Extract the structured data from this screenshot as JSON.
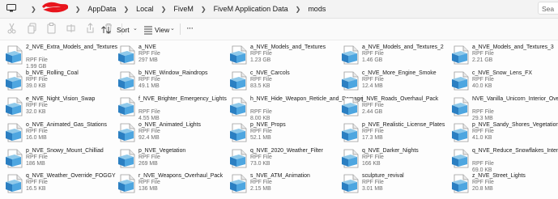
{
  "address": {
    "crumbs": [
      "AppData",
      "Local",
      "FiveM",
      "FiveM Application Data",
      "mods"
    ],
    "search_placeholder": "Sea"
  },
  "toolbar": {
    "sort_label": "Sort",
    "view_label": "View",
    "more_label": "···"
  },
  "files": [
    {
      "name": "2_NVE_Extra_Models_and_Textures",
      "type": "RPF File",
      "size": "1.99 GB"
    },
    {
      "name": "a_NVE",
      "type": "RPF File",
      "size": "297 MB"
    },
    {
      "name": "a_NVE_Models_and_Textures",
      "type": "RPF File",
      "size": "1.23 GB"
    },
    {
      "name": "a_NVE_Models_and_Textures_2",
      "type": "RPF File",
      "size": "1.46 GB"
    },
    {
      "name": "a_NVE_Models_and_Textures_3",
      "type": "RPF File",
      "size": "2.21 GB"
    },
    {
      "name": "b_NVE_Rolling_Coal",
      "type": "RPF File",
      "size": "39.0 KB"
    },
    {
      "name": "b_NVE_Window_Raindrops",
      "type": "RPF File",
      "size": "49.1 MB"
    },
    {
      "name": "c_NVE_Carcols",
      "type": "RPF File",
      "size": "83.5 KB"
    },
    {
      "name": "c_NVE_More_Engine_Smoke",
      "type": "RPF File",
      "size": "12.4 MB"
    },
    {
      "name": "c_NVE_Snow_Lens_FX",
      "type": "RPF File",
      "size": "40.0 KB"
    },
    {
      "name": "e_NVE_Night_Vision_Swap",
      "type": "RPF File",
      "size": "32.0 KB"
    },
    {
      "name": "f_NVE_Brighter_Emergency_Lights",
      "type": "RPF File",
      "size": "4.55 MB"
    },
    {
      "name": "h_NVE_Hide_Weapon_Reticle_and_Damage",
      "type": "RPF File",
      "size": "8.00 KB"
    },
    {
      "name": "j_NVE_Roads_Overhaul_Pack",
      "type": "RPF File",
      "size": "2.44 GB"
    },
    {
      "name": "NVE_Vanilla_Unicorn_Interior_Overhaul",
      "type": "RPF File",
      "size": "29.3 MB"
    },
    {
      "name": "o_NVE_Animated_Gas_Stations",
      "type": "RPF File",
      "size": "16.0 MB"
    },
    {
      "name": "o_NVE_Animated_Lights",
      "type": "RPF File",
      "size": "92.4 MB"
    },
    {
      "name": "p_NVE_Props",
      "type": "RPF File",
      "size": "52.1 MB"
    },
    {
      "name": "p_NVE_Realistic_License_Plates",
      "type": "RPF File",
      "size": "17.3 MB"
    },
    {
      "name": "p_NVE_Sandy_Shores_Vegetation",
      "type": "RPF File",
      "size": "41.0 KB"
    },
    {
      "name": "p_NVE_Snowy_Mount_Chilliad",
      "type": "RPF File",
      "size": "186 MB"
    },
    {
      "name": "p_NVE_Vegetation",
      "type": "RPF File",
      "size": "269 MB"
    },
    {
      "name": "q_NVE_2020_Weather_Filter",
      "type": "RPF File",
      "size": "73.0 KB"
    },
    {
      "name": "q_NVE_Darker_Nights",
      "type": "RPF File",
      "size": "166 KB"
    },
    {
      "name": "q_NVE_Reduce_Snowflakes_Intensity",
      "type": "RPF File",
      "size": "69.0 KB"
    },
    {
      "name": "q_NVE_Weather_Override_FOGGY",
      "type": "RPF File",
      "size": "16.5 KB"
    },
    {
      "name": "r_NVE_Weapons_Overhaul_Pack",
      "type": "RPF File",
      "size": "136 MB"
    },
    {
      "name": "s_NVE_ATM_Animation",
      "type": "RPF File",
      "size": "2.15 MB"
    },
    {
      "name": "sculpture_revival",
      "type": "RPF File",
      "size": "3.01 MB"
    },
    {
      "name": "z_NVE_Street_Lights",
      "type": "RPF File",
      "size": "20.8 MB"
    }
  ],
  "colors": {
    "accent": "#1f63c6",
    "redaction": "#e8141c"
  }
}
